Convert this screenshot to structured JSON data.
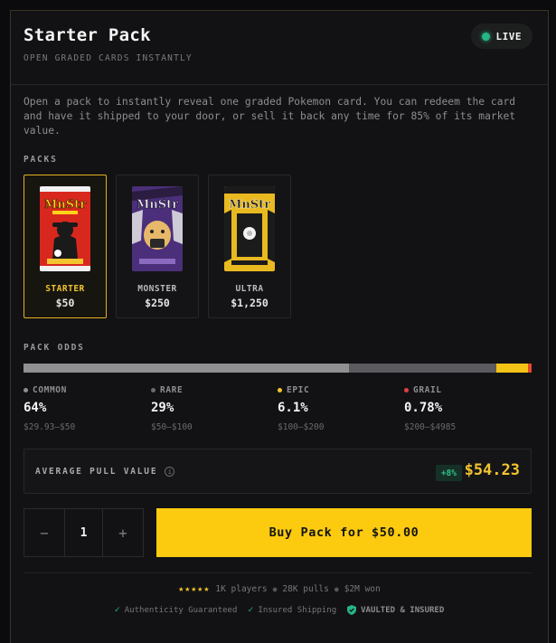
{
  "header": {
    "title": "Starter Pack",
    "subtitle": "OPEN GRADED CARDS INSTANTLY",
    "live_label": "LIVE"
  },
  "description": "Open a pack to instantly reveal one graded Pokemon card. You can redeem the card and have it shipped to your door, or sell it back any time for 85% of its market value.",
  "packs_label": "PACKS",
  "packs": [
    {
      "name": "STARTER",
      "price": "$50",
      "brand": "MnStr",
      "selected": true,
      "color": "#d8281e"
    },
    {
      "name": "MONSTER",
      "price": "$250",
      "brand": "MnStr",
      "selected": false,
      "color": "#5b3c8f"
    },
    {
      "name": "ULTRA",
      "price": "$1,250",
      "brand": "MnStr",
      "selected": false,
      "color": "#e9b920"
    }
  ],
  "odds_label": "PACK ODDS",
  "odds": [
    {
      "tier": "COMMON",
      "pct": "64%",
      "share": 0.64,
      "range": "$29.93–$50",
      "color": "#8e8e92",
      "bar_color": "#909093"
    },
    {
      "tier": "RARE",
      "pct": "29%",
      "share": 0.29,
      "range": "$50–$100",
      "color": "#6b6b70",
      "bar_color": "#5a5a5f"
    },
    {
      "tier": "EPIC",
      "pct": "6.1%",
      "share": 0.061,
      "range": "$100–$200",
      "color": "#f3c42f",
      "bar_color": "#f4c318"
    },
    {
      "tier": "GRAIL",
      "pct": "0.78%",
      "share": 0.0078,
      "range": "$200–$4985",
      "color": "#e04040",
      "bar_color": "#e24a2a"
    }
  ],
  "average": {
    "label": "AVERAGE PULL VALUE",
    "delta": "+8%",
    "value": "$54.23"
  },
  "quantity": {
    "minus": "−",
    "value": "1",
    "plus": "+"
  },
  "buy_label": "Buy Pack for $50.00",
  "stats": {
    "stars": "★★★★★",
    "players": "1K players",
    "pulls": "28K pulls",
    "won": "$2M won"
  },
  "trust": {
    "authenticity": "Authenticity Guaranteed",
    "shipping": "Insured Shipping",
    "vaulted": "VAULTED & INSURED"
  }
}
